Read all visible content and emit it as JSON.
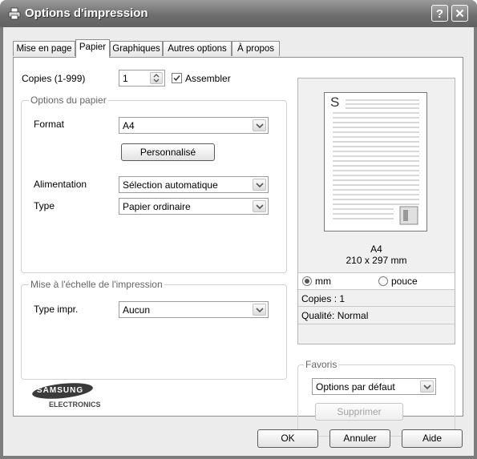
{
  "window": {
    "title": "Options d'impression",
    "help_glyph": "?",
    "close_glyph": "✕"
  },
  "tabs": [
    {
      "label": "Mise en page"
    },
    {
      "label": "Papier"
    },
    {
      "label": "Graphiques"
    },
    {
      "label": "Autres options"
    },
    {
      "label": "À propos"
    }
  ],
  "copies": {
    "label": "Copies (1-999)",
    "value": "1",
    "collate_label": "Assembler",
    "collate_checked": true
  },
  "paper_options": {
    "title": "Options du papier",
    "format_label": "Format",
    "format_value": "A4",
    "custom_button": "Personnalisé",
    "source_label": "Alimentation",
    "source_value": "Sélection automatique",
    "type_label": "Type",
    "type_value": "Papier ordinaire"
  },
  "scaling": {
    "title": "Mise à l'échelle de l'impression",
    "type_label": "Type impr.",
    "type_value": "Aucun"
  },
  "logo": {
    "brand": "SAMSUNG",
    "sub": "ELECTRONICS"
  },
  "preview": {
    "page_letter": "S",
    "paper_name": "A4",
    "paper_size": "210 x 297 mm",
    "unit_mm": "mm",
    "unit_inch": "pouce",
    "selected_unit": "mm",
    "copies_text": "Copies : 1",
    "quality_text": "Qualité: Normal"
  },
  "favorites": {
    "title": "Favoris",
    "value": "Options par défaut",
    "delete_button": "Supprimer"
  },
  "footer": {
    "ok": "OK",
    "cancel": "Annuler",
    "help": "Aide"
  }
}
